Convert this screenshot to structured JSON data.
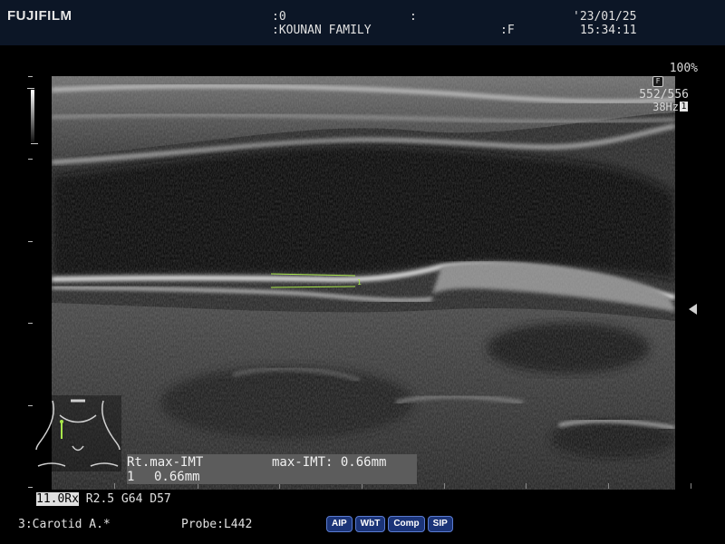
{
  "header": {
    "brand": "FUJIFILM",
    "patient_id": ":0",
    "sep_colon": ":",
    "date": "'23/01/25",
    "patient_name": ":KOUNAN FAMILY",
    "sex": ":F",
    "time": "15:34:11"
  },
  "image_info": {
    "zoom": "100%",
    "focus_badge": "F",
    "frame": "552/556",
    "frame_rate": "38Hz",
    "frame_rate_badge": "1"
  },
  "measurement": {
    "title": "Rt.max-IMT",
    "summary": "max-IMT: 0.66mm",
    "line_index": "1",
    "line_value": "0.66mm",
    "caliper_label": "1"
  },
  "params": {
    "freq": "11.0Rx",
    "rest": "R2.5 G64 D57"
  },
  "footer": {
    "preset": "3:Carotid A.*",
    "probe": "Probe:L442",
    "modes": [
      "AIP",
      "WbT",
      "Comp",
      "SIP"
    ]
  },
  "colors": {
    "header_bg": "#0c1626",
    "caliper": "#a8e64b",
    "mode_badge_bg": "#1b3478"
  },
  "icons": {
    "body_mark": "neck-body-mark-icon",
    "gray_scale": "grayscale-bar-icon",
    "focus": "focus-marker-icon"
  }
}
